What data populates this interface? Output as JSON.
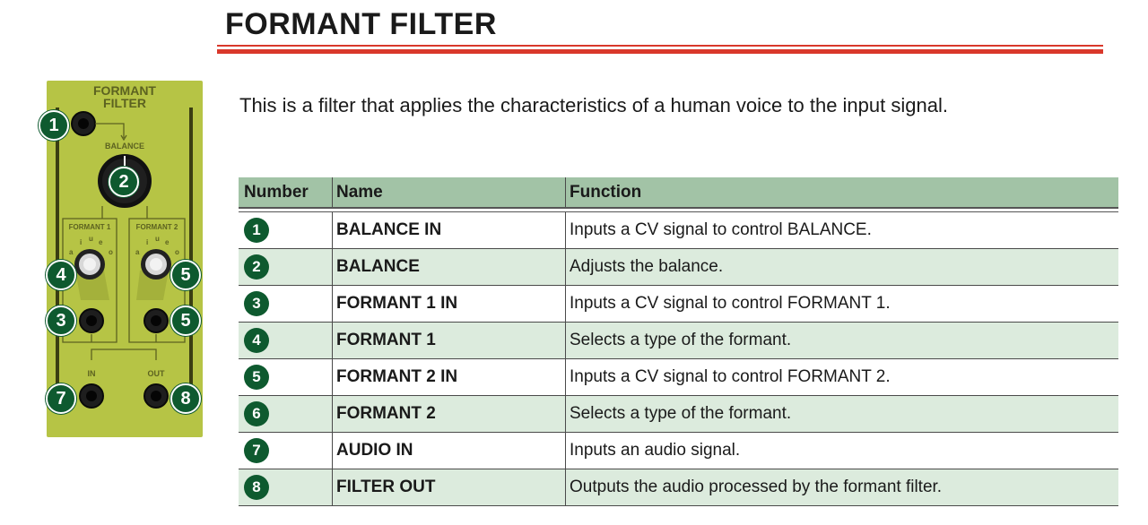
{
  "page": {
    "title": "FORMANT FILTER",
    "intro": "This is a filter that applies the characteristics of a human voice to the input signal."
  },
  "panel": {
    "title_line1": "FORMANT",
    "title_line2": "FILTER",
    "balance_label": "BALANCE",
    "formant1_label": "FORMANT 1",
    "formant2_label": "FORMANT 2",
    "vowels": [
      "a",
      "i",
      "u",
      "e",
      "o"
    ],
    "in_label": "IN",
    "out_label": "OUT",
    "badges": [
      "1",
      "2",
      "4",
      "5",
      "3",
      "5",
      "7",
      "8"
    ]
  },
  "table": {
    "headers": {
      "number": "Number",
      "name": "Name",
      "function": "Function"
    },
    "rows": [
      {
        "num": "1",
        "name": "BALANCE IN",
        "func": "Inputs a CV signal to control BALANCE."
      },
      {
        "num": "2",
        "name": "BALANCE",
        "func": "Adjusts the balance."
      },
      {
        "num": "3",
        "name": "FORMANT 1 IN",
        "func": "Inputs a CV signal to control FORMANT 1."
      },
      {
        "num": "4",
        "name": "FORMANT 1",
        "func": "Selects a type of the formant."
      },
      {
        "num": "5",
        "name": "FORMANT 2 IN",
        "func": "Inputs a CV signal to control FORMANT 2."
      },
      {
        "num": "6",
        "name": "FORMANT 2",
        "func": "Selects a type of the formant."
      },
      {
        "num": "7",
        "name": "AUDIO IN",
        "func": "Inputs an audio signal."
      },
      {
        "num": "8",
        "name": "FILTER OUT",
        "func": "Outputs the audio processed by the formant filter."
      }
    ]
  },
  "colors": {
    "accent_red": "#d9382b",
    "badge_green": "#0e5a2f",
    "header_green": "#a2c3a6",
    "row_alt_green": "#dcebdd",
    "panel_olive": "#b6c445"
  }
}
